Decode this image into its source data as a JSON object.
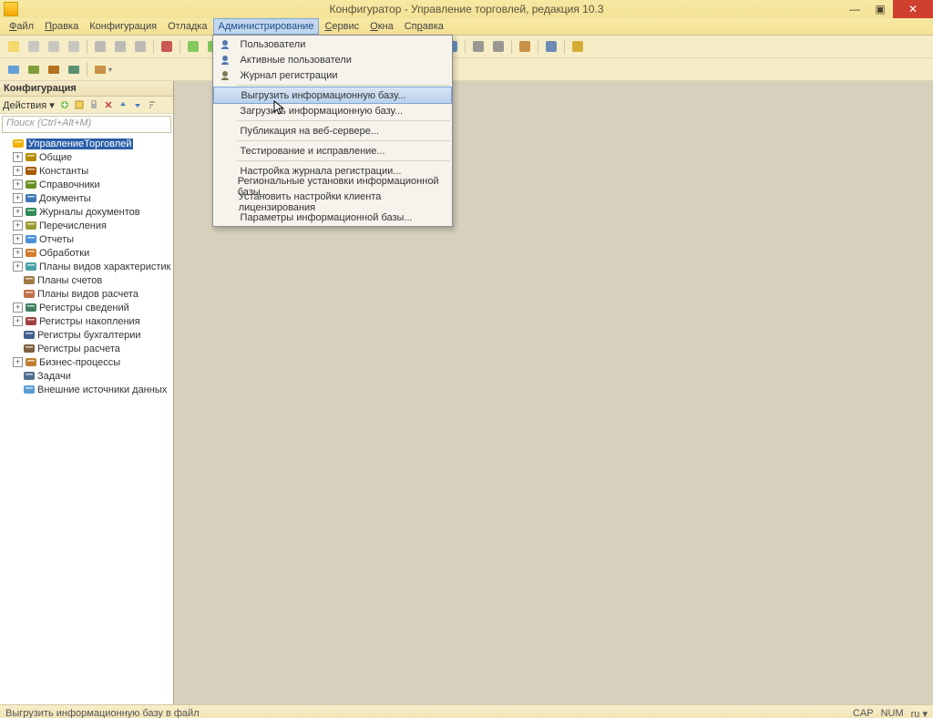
{
  "title": "Конфигуратор - Управление торговлей, редакция 10.3",
  "winbtns": {
    "min": "—",
    "max": "▣",
    "close": "✕"
  },
  "menu": {
    "file": "<u>Ф</u>айл",
    "edit": "<u>П</u>равка",
    "config": "Конфигурация",
    "debug": "Отладка",
    "admin": "Администрирование",
    "service": "<u>С</u>ервис",
    "windows": "<u>О</u>кна",
    "help": "Сп<u>р</u>авка"
  },
  "panel": {
    "title": "Конфигурация",
    "actions": "Действия ▾"
  },
  "search_placeholder": "Поиск (Ctrl+Alt+M)",
  "tree": [
    {
      "label": "УправлениеТорговлей",
      "icon": "globe",
      "exp": " ",
      "depth": 0,
      "sel": true
    },
    {
      "label": "Общие",
      "icon": "cube",
      "exp": "+",
      "depth": 1
    },
    {
      "label": "Константы",
      "icon": "abc",
      "exp": "+",
      "depth": 1
    },
    {
      "label": "Справочники",
      "icon": "book",
      "exp": "+",
      "depth": 1
    },
    {
      "label": "Документы",
      "icon": "doc",
      "exp": "+",
      "depth": 1
    },
    {
      "label": "Журналы документов",
      "icon": "journal",
      "exp": "+",
      "depth": 1
    },
    {
      "label": "Перечисления",
      "icon": "enum",
      "exp": "+",
      "depth": 1
    },
    {
      "label": "Отчеты",
      "icon": "report",
      "exp": "+",
      "depth": 1
    },
    {
      "label": "Обработки",
      "icon": "proc",
      "exp": "+",
      "depth": 1
    },
    {
      "label": "Планы видов характеристик",
      "icon": "plan",
      "exp": "+",
      "depth": 1
    },
    {
      "label": "Планы счетов",
      "icon": "acct",
      "exp": " ",
      "depth": 1
    },
    {
      "label": "Планы видов расчета",
      "icon": "calc",
      "exp": " ",
      "depth": 1
    },
    {
      "label": "Регистры сведений",
      "icon": "reg",
      "exp": "+",
      "depth": 1
    },
    {
      "label": "Регистры накопления",
      "icon": "regacc",
      "exp": "+",
      "depth": 1
    },
    {
      "label": "Регистры бухгалтерии",
      "icon": "regbuh",
      "exp": " ",
      "depth": 1
    },
    {
      "label": "Регистры расчета",
      "icon": "regcalc",
      "exp": " ",
      "depth": 1
    },
    {
      "label": "Бизнес-процессы",
      "icon": "bp",
      "exp": "+",
      "depth": 1
    },
    {
      "label": "Задачи",
      "icon": "task",
      "exp": " ",
      "depth": 1
    },
    {
      "label": "Внешние источники данных",
      "icon": "ext",
      "exp": " ",
      "depth": 1
    }
  ],
  "dropdown": [
    {
      "t": "item",
      "label": "Пользователи",
      "icon": "user"
    },
    {
      "t": "item",
      "label": "Активные пользователи",
      "icon": "users"
    },
    {
      "t": "item",
      "label": "Журнал регистрации",
      "icon": "log"
    },
    {
      "t": "sep"
    },
    {
      "t": "item",
      "label": "Выгрузить информационную базу...",
      "hover": true
    },
    {
      "t": "item",
      "label": "Загрузить информационную базу..."
    },
    {
      "t": "sep"
    },
    {
      "t": "item",
      "label": "Публикация на веб-сервере..."
    },
    {
      "t": "sep"
    },
    {
      "t": "item",
      "label": "Тестирование и исправление..."
    },
    {
      "t": "sep"
    },
    {
      "t": "item",
      "label": "Настройка журнала регистрации..."
    },
    {
      "t": "item",
      "label": "Региональные установки информационной базы..."
    },
    {
      "t": "item",
      "label": "Установить настройки клиента лицензирования"
    },
    {
      "t": "item",
      "label": "Параметры информационной базы..."
    }
  ],
  "status": {
    "left": "Выгрузить информационную базу в файл",
    "cap": "CAP",
    "num": "NUM",
    "lang": "ru ▾"
  },
  "icon_colors": {
    "globe": "#f2b200",
    "cube": "#b58a00",
    "abc": "#a85b00",
    "book": "#6b8e23",
    "doc": "#3b78b5",
    "journal": "#2e8b57",
    "enum": "#999933",
    "report": "#4a90d9",
    "proc": "#d07c2e",
    "plan": "#4aa3a3",
    "acct": "#9f7a42",
    "calc": "#c07048",
    "reg": "#408060",
    "regacc": "#a04040",
    "regbuh": "#406090",
    "regcalc": "#806040",
    "bp": "#c08030",
    "task": "#507090",
    "ext": "#5a9bd4",
    "user": "#5478b0",
    "users": "#5478b0",
    "log": "#7a7a50"
  }
}
